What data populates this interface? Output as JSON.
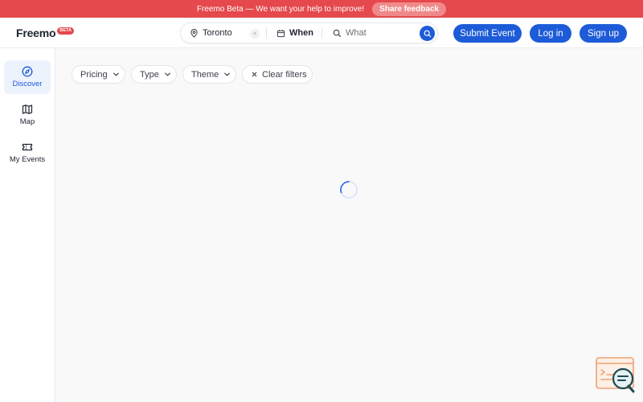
{
  "banner": {
    "message": "Freemo Beta — We want your help to improve!",
    "feedback_label": "Share feedback"
  },
  "header": {
    "logo_name": "Freemo",
    "logo_badge": "BETA",
    "search": {
      "location": "Toronto",
      "location_clear": "×",
      "when_label": "When",
      "what_placeholder": "What"
    },
    "buttons": {
      "submit": "Submit Event",
      "login": "Log in",
      "signup": "Sign up"
    }
  },
  "sidebar": {
    "items": [
      {
        "label": "Discover",
        "icon": "compass-icon",
        "active": true
      },
      {
        "label": "Map",
        "icon": "map-icon",
        "active": false
      },
      {
        "label": "My Events",
        "icon": "ticket-icon",
        "active": false
      }
    ]
  },
  "filters": {
    "pricing": "Pricing",
    "type": "Type",
    "theme": "Theme",
    "clear": "Clear filters"
  },
  "colors": {
    "banner": "#e5484d",
    "primary": "#1d5bd8",
    "active_bg": "#edf3fd",
    "chat_accent": "#f0a072",
    "chat_dark": "#1e4a52"
  }
}
